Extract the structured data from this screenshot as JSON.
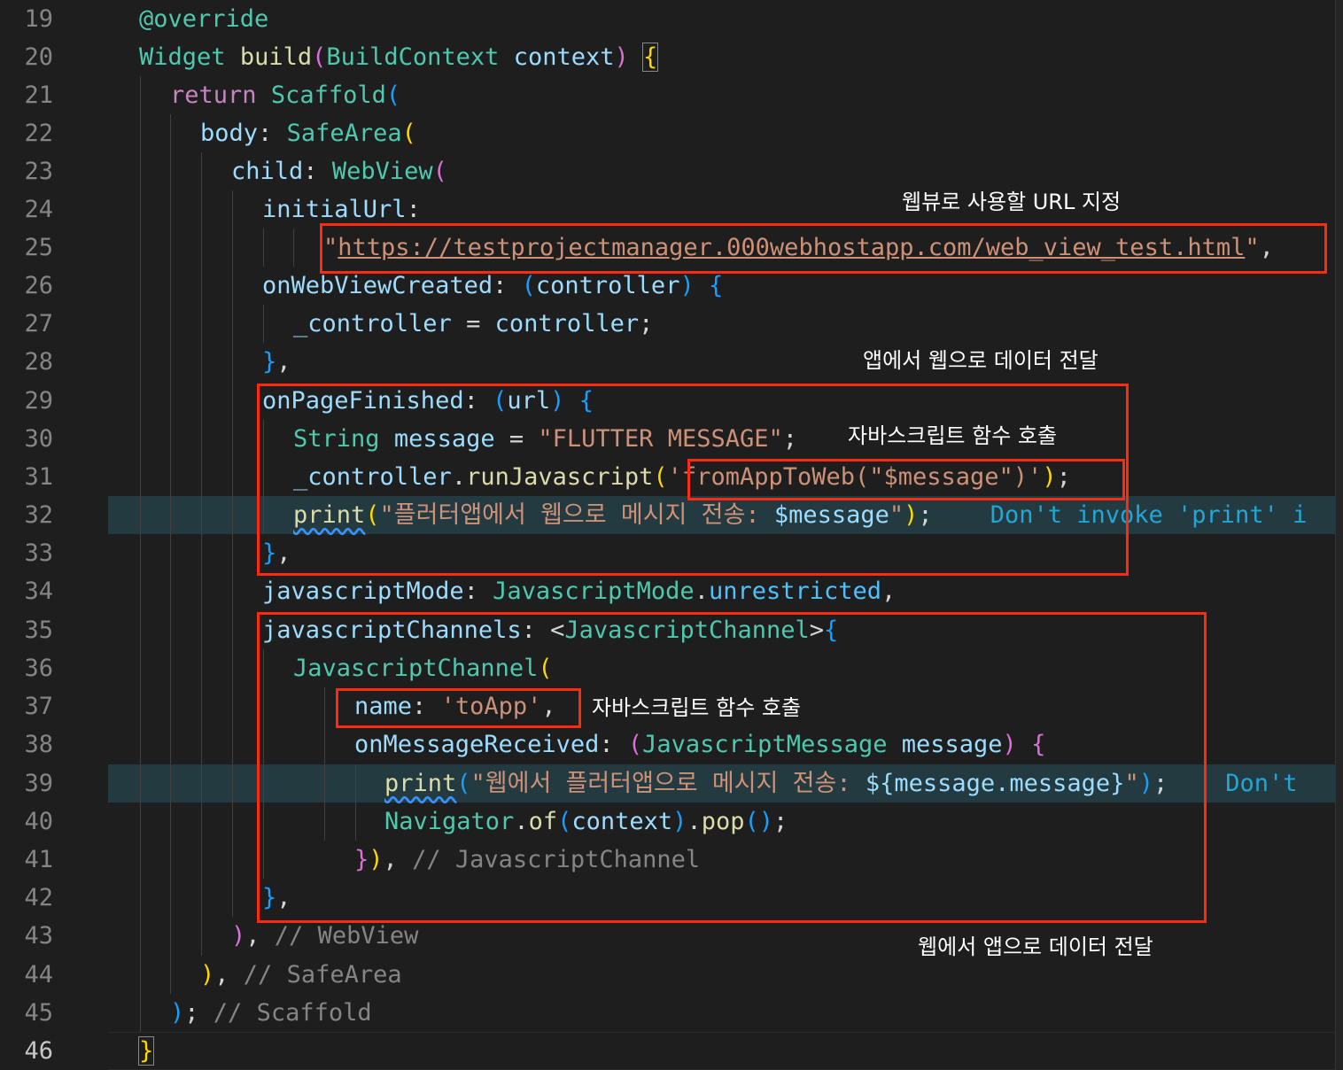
{
  "line_numbers": [
    "19",
    "20",
    "21",
    "22",
    "23",
    "24",
    "25",
    "26",
    "27",
    "28",
    "29",
    "30",
    "31",
    "32",
    "33",
    "34",
    "35",
    "36",
    "37",
    "38",
    "39",
    "40",
    "41",
    "42",
    "43",
    "44",
    "45",
    "46"
  ],
  "code": {
    "l19": {
      "decorator": "@override"
    },
    "l20": {
      "type": "Widget",
      "fn": "build",
      "open": "(",
      "ptype": "BuildContext",
      "param": "context",
      "close": ")",
      "brace": "{"
    },
    "l21": {
      "kw": "return",
      "type": "Scaffold",
      "open": "("
    },
    "l22": {
      "prop": "body",
      "colon": ":",
      "type": "SafeArea",
      "open": "("
    },
    "l23": {
      "prop": "child",
      "colon": ":",
      "type": "WebView",
      "open": "("
    },
    "l24": {
      "prop": "initialUrl",
      "colon": ":"
    },
    "l25": {
      "q1": "\"",
      "url": "https://testprojectmanager.000webhostapp.com/web_view_test.html",
      "q2": "\"",
      "comma": ","
    },
    "l26": {
      "prop": "onWebViewCreated",
      "colon": ":",
      "open": "(",
      "param": "controller",
      "close": ")",
      "brace": "{"
    },
    "l27": {
      "lhs": "_controller",
      "eq": " = ",
      "rhs": "controller",
      "semi": ";"
    },
    "l28": {
      "close": "}",
      "comma": ","
    },
    "l29": {
      "prop": "onPageFinished",
      "colon": ":",
      "open": "(",
      "param": "url",
      "close": ")",
      "brace": "{"
    },
    "l30": {
      "type": "String",
      "var": "message",
      "eq": " = ",
      "str": "\"FLUTTER MESSAGE\"",
      "semi": ";"
    },
    "l31": {
      "obj": "_controller",
      "dot": ".",
      "fn": "runJavascript",
      "open": "(",
      "str": "'fromAppToWeb(\"$message\")'",
      "close": ")",
      "semi": ";"
    },
    "l32": {
      "fn": "print",
      "open": "(",
      "str": "\"플러터앱에서 웹으로 메시지 전송: ",
      "interp": "$message",
      "str_end": "\"",
      "close": ")",
      "semi": ";",
      "warning": "Don't invoke 'print' i"
    },
    "l33": {
      "close": "}",
      "comma": ","
    },
    "l34": {
      "prop": "javascriptMode",
      "colon": ":",
      "type": "JavascriptMode",
      "dot": ".",
      "member": "unrestricted",
      "comma": ","
    },
    "l35": {
      "prop": "javascriptChannels",
      "colon": ":",
      "lt": "<",
      "type": "JavascriptChannel",
      "gt": ">",
      "brace": "{"
    },
    "l36": {
      "type": "JavascriptChannel",
      "open": "("
    },
    "l37": {
      "prop": "name",
      "colon": ":",
      "str": "'toApp'",
      "comma": ","
    },
    "l38": {
      "prop": "onMessageReceived",
      "colon": ":",
      "open": "(",
      "ptype": "JavascriptMessage",
      "param": "message",
      "close": ")",
      "brace": "{"
    },
    "l39": {
      "fn": "print",
      "open": "(",
      "str": "\"웹에서 플러터앱으로 메시지 전송: ",
      "interp": "${message.message}",
      "str_end": "\"",
      "close": ")",
      "semi": ";",
      "warning": "Don't"
    },
    "l40": {
      "type": "Navigator",
      "dot": ".",
      "fn": "of",
      "open": "(",
      "param": "context",
      "close": ")",
      "dot2": ".",
      "fn2": "pop",
      "call": "()",
      "semi": ";"
    },
    "l41": {
      "brace": "}",
      "close": ")",
      "comma": ",",
      "comment": "// JavascriptChannel"
    },
    "l42": {
      "close": "}",
      "comma": ","
    },
    "l43": {
      "close": ")",
      "comma": ",",
      "comment": "// WebView"
    },
    "l44": {
      "close": ")",
      "comma": ",",
      "comment": "// SafeArea"
    },
    "l45": {
      "close": ")",
      "semi": ";",
      "comment": "// Scaffold"
    },
    "l46": {
      "close": "}"
    }
  },
  "annotations": {
    "url_note": "웹뷰로 사용할 URL 지정",
    "app_to_web_note": "앱에서 웹으로 데이터 전달",
    "js_call_note_1": "자바스크립트 함수 호출",
    "js_call_note_2": "자바스크립트 함수 호출",
    "web_to_app_note": "웹에서 앱으로 데이터 전달"
  },
  "colors": {
    "background": "#1e1e1e",
    "annotation_box": "#ff2a12",
    "keyword": "#c586c0",
    "type": "#4ec9b0",
    "function": "#dcdcaa",
    "identifier": "#9cdcfe",
    "string": "#ce9178",
    "comment": "#6a9955"
  }
}
